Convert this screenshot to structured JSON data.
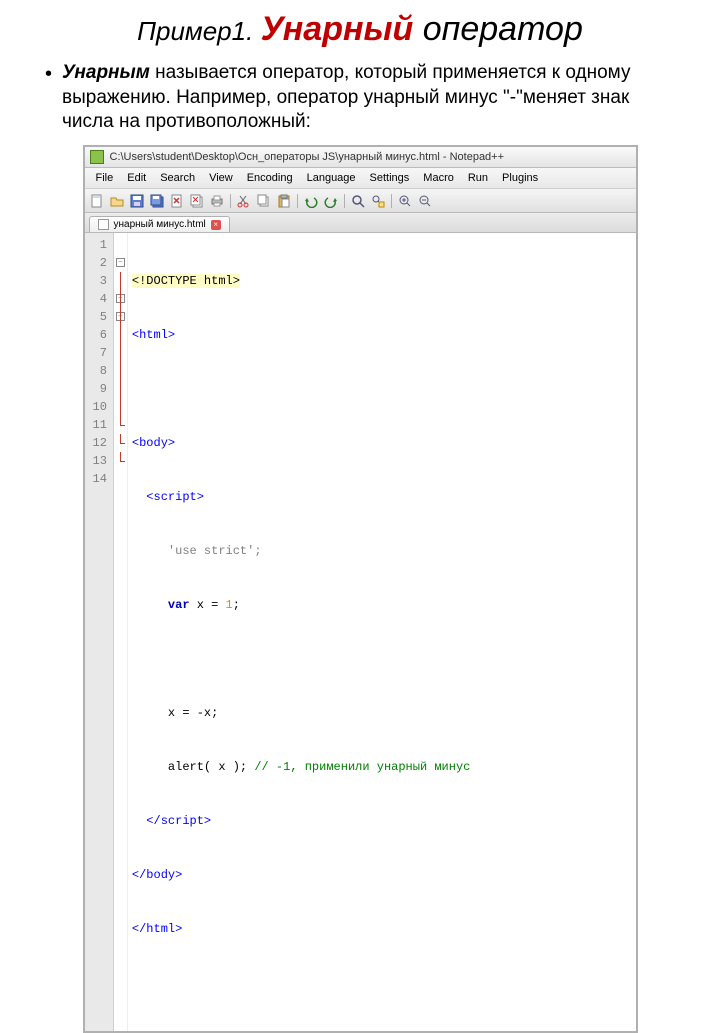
{
  "title": {
    "part1": "Пример1. ",
    "part2": "Унарный",
    "part3": " оператор"
  },
  "bullet": {
    "bold": "Унарным",
    "rest": " называется оператор, который применяется к одному выражению. Например, оператор унарный минус \"-\"меняет знак числа на противоположный:"
  },
  "npp": {
    "path": "C:\\Users\\student\\Desktop\\Осн_операторы JS\\унарный минус.html - Notepad++",
    "menu": [
      "File",
      "Edit",
      "Search",
      "View",
      "Encoding",
      "Language",
      "Settings",
      "Macro",
      "Run",
      "Plugins"
    ],
    "tab": "унарный минус.html",
    "lines": [
      "1",
      "2",
      "3",
      "4",
      "5",
      "6",
      "7",
      "8",
      "9",
      "10",
      "11",
      "12",
      "13",
      "14"
    ],
    "code": {
      "l1": "<!DOCTYPE html>",
      "l2": "<html>",
      "l4": "<body>",
      "l5": "  <script>",
      "l6": "     'use strict';",
      "l7a": "     ",
      "l7kw": "var",
      "l7b": " x = ",
      "l7num": "1",
      "l7c": ";",
      "l9": "     x = -x;",
      "l10a": "     alert( x );",
      "l10cmt": " // -1, применили унарный минус",
      "l11": "  </script>",
      "l12": "</body>",
      "l13": "</html>"
    }
  }
}
